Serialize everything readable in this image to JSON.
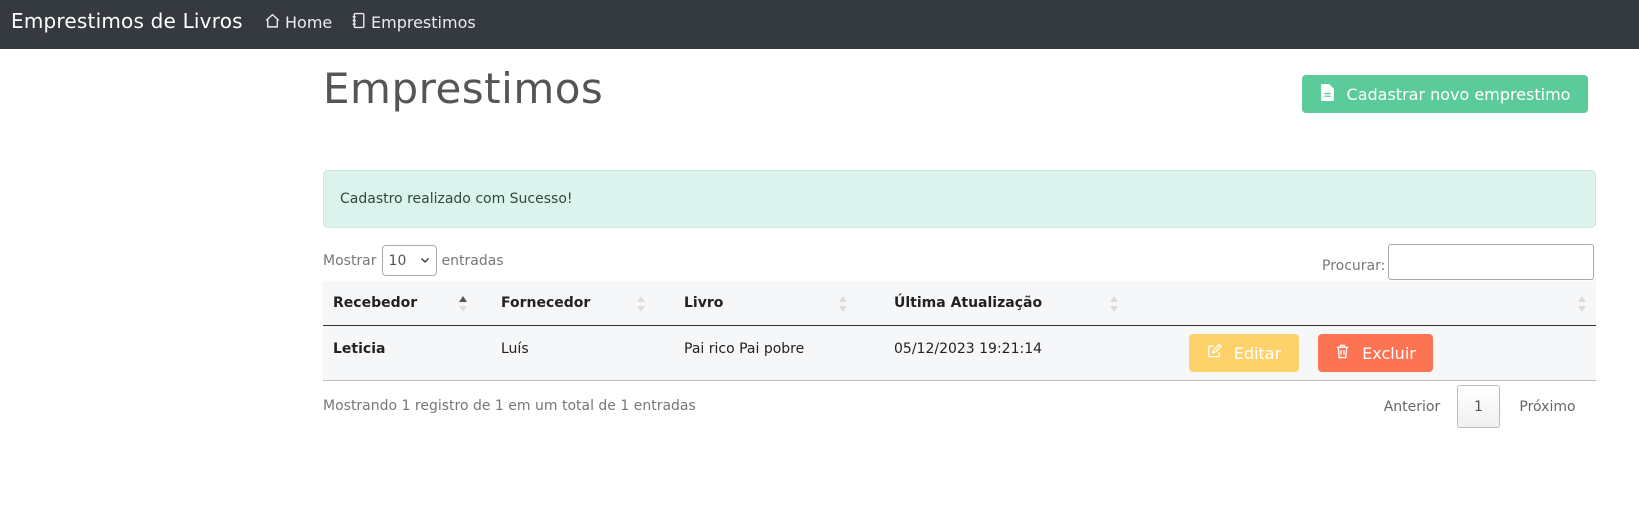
{
  "navbar": {
    "brand": "Emprestimos de Livros",
    "links": [
      {
        "label": "Home",
        "icon": "house-icon"
      },
      {
        "label": "Emprestimos",
        "icon": "journal-icon"
      }
    ]
  },
  "header": {
    "title": "Emprestimos",
    "new_button_label": "Cadastrar novo emprestimo",
    "new_button_icon": "file-icon"
  },
  "alert": {
    "message": "Cadastro realizado com Sucesso!"
  },
  "table_controls": {
    "show_label": "Mostrar",
    "page_size": "10",
    "entries_label": "entradas",
    "search_label": "Procurar:"
  },
  "table": {
    "columns": [
      "Recebedor",
      "Fornecedor",
      "Livro",
      "Última Atualização",
      ""
    ],
    "rows": [
      {
        "recebedor": "Leticia",
        "fornecedor": "Luís",
        "livro": "Pai rico Pai pobre",
        "atualizacao": "05/12/2023 19:21:14",
        "edit_label": "Editar",
        "delete_label": "Excluir"
      }
    ]
  },
  "footer": {
    "info": "Mostrando 1 registro de 1 em um total de 1 entradas",
    "prev_label": "Anterior",
    "current_page": "1",
    "next_label": "Próximo"
  },
  "colors": {
    "navbar": "#343a40",
    "success": "#5bcb9c",
    "warning": "#fdd26a",
    "danger": "#fd7454",
    "alert_bg": "#dbf3ec"
  }
}
